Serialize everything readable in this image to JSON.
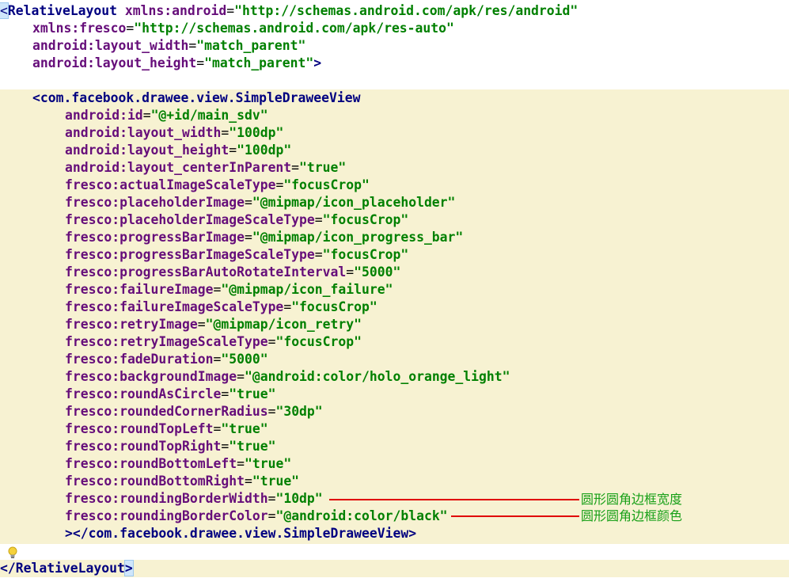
{
  "code": {
    "root_open": {
      "open": "<RelativeLayout",
      "ns_android_attr": "xmlns:android",
      "ns_android_val": "\"http://schemas.android.com/apk/res/android\"",
      "ns_fresco_attr": "xmlns:fresco",
      "ns_fresco_val": "\"http://schemas.android.com/apk/res-auto\"",
      "width_attr": "android:layout_width",
      "width_val": "\"match_parent\"",
      "height_attr": "android:layout_height",
      "height_val": "\"match_parent\"",
      "close": ">"
    },
    "drawee_open": "<com.facebook.drawee.view.SimpleDraweeView",
    "attributes": [
      {
        "name": "android:id",
        "value": "\"@+id/main_sdv\""
      },
      {
        "name": "android:layout_width",
        "value": "\"100dp\""
      },
      {
        "name": "android:layout_height",
        "value": "\"100dp\""
      },
      {
        "name": "android:layout_centerInParent",
        "value": "\"true\""
      },
      {
        "name": "fresco:actualImageScaleType",
        "value": "\"focusCrop\""
      },
      {
        "name": "fresco:placeholderImage",
        "value": "\"@mipmap/icon_placeholder\""
      },
      {
        "name": "fresco:placeholderImageScaleType",
        "value": "\"focusCrop\""
      },
      {
        "name": "fresco:progressBarImage",
        "value": "\"@mipmap/icon_progress_bar\""
      },
      {
        "name": "fresco:progressBarImageScaleType",
        "value": "\"focusCrop\""
      },
      {
        "name": "fresco:progressBarAutoRotateInterval",
        "value": "\"5000\""
      },
      {
        "name": "fresco:failureImage",
        "value": "\"@mipmap/icon_failure\""
      },
      {
        "name": "fresco:failureImageScaleType",
        "value": "\"focusCrop\""
      },
      {
        "name": "fresco:retryImage",
        "value": "\"@mipmap/icon_retry\""
      },
      {
        "name": "fresco:retryImageScaleType",
        "value": "\"focusCrop\""
      },
      {
        "name": "fresco:fadeDuration",
        "value": "\"5000\""
      },
      {
        "name": "fresco:backgroundImage",
        "value": "\"@android:color/holo_orange_light\""
      },
      {
        "name": "fresco:roundAsCircle",
        "value": "\"true\""
      },
      {
        "name": "fresco:roundedCornerRadius",
        "value": "\"30dp\""
      },
      {
        "name": "fresco:roundTopLeft",
        "value": "\"true\""
      },
      {
        "name": "fresco:roundTopRight",
        "value": "\"true\""
      },
      {
        "name": "fresco:roundBottomLeft",
        "value": "\"true\""
      },
      {
        "name": "fresco:roundBottomRight",
        "value": "\"true\""
      },
      {
        "name": "fresco:roundingBorderWidth",
        "value": "\"10dp\""
      },
      {
        "name": "fresco:roundingBorderColor",
        "value": "\"@android:color/black\""
      }
    ],
    "drawee_close_gt": ">",
    "drawee_close_tag": "</com.facebook.drawee.view.SimpleDraweeView",
    "drawee_close_end": ">",
    "root_close_tag": "</RelativeLayout",
    "root_close_end": ">"
  },
  "annotations": {
    "border_width": "圆形圆角边框宽度",
    "border_color": "圆形圆角边框颜色"
  },
  "colors": {
    "tag": "#000080",
    "attribute": "#660e7a",
    "value": "#008000",
    "highlight": "#f7f2d2",
    "annotation_text": "#18a018",
    "annotation_line": "#e00000"
  },
  "icons": {
    "gutter": "lightbulb-icon"
  }
}
